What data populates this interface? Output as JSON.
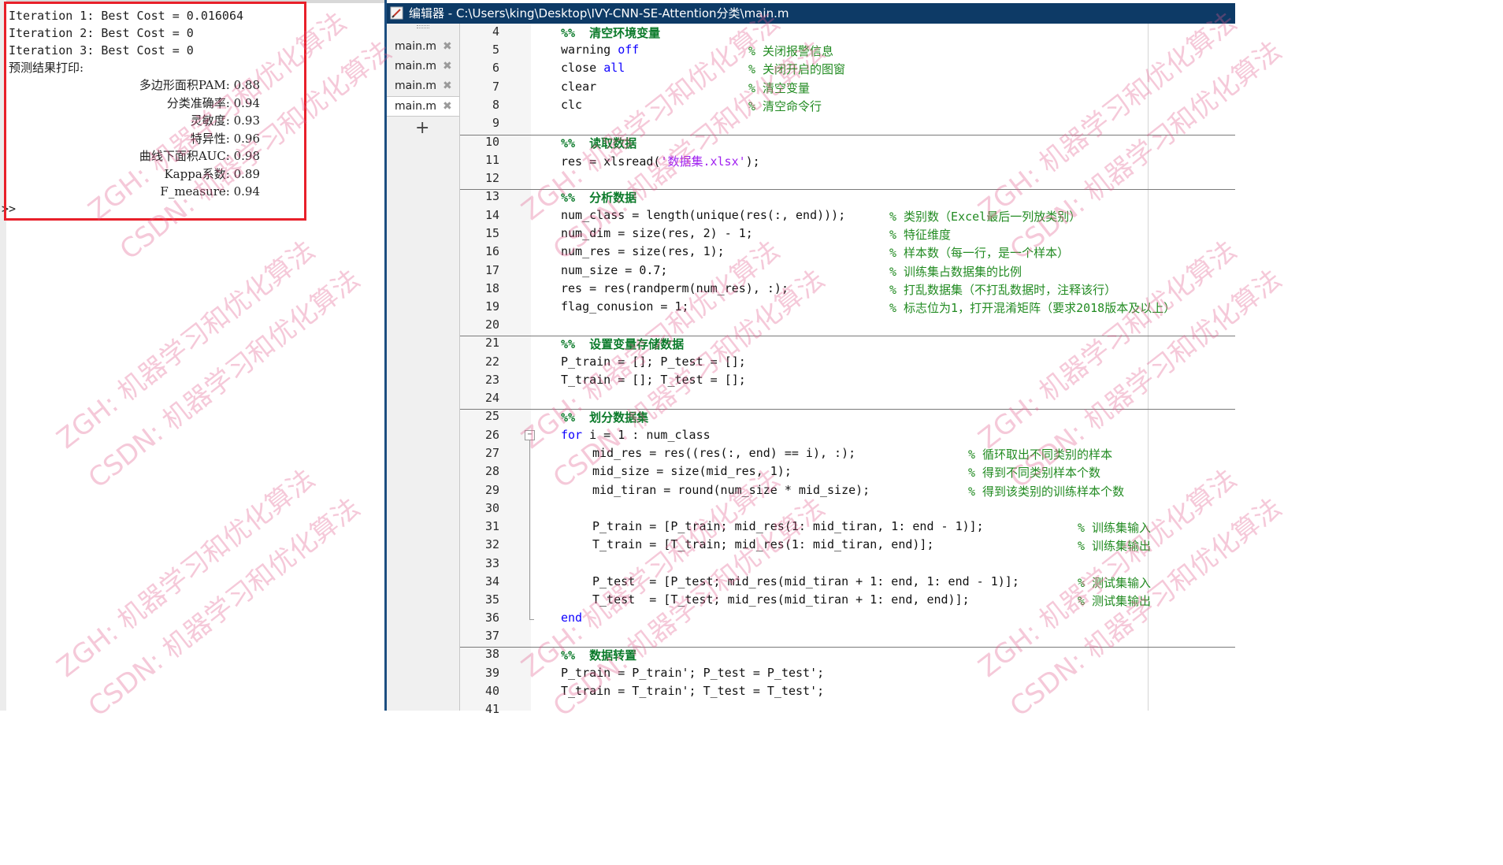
{
  "command_window": {
    "iterations": [
      "Iteration 1: Best Cost = 0.016064",
      "Iteration 2: Best Cost = 0",
      "Iteration 3: Best Cost = 0"
    ],
    "print_header": "预测结果打印:",
    "metrics": [
      "多边形面积PAM: 0.88",
      "分类准确率: 0.94",
      "灵敏度: 0.93",
      "特异性: 0.96",
      "曲线下面积AUC: 0.98",
      "Kappa系数: 0.89",
      "F_measure: 0.94"
    ],
    "prompt": ">>"
  },
  "editor": {
    "title": "编辑器 - C:\\Users\\king\\Desktop\\IVY-CNN-SE-Attention分类\\main.m",
    "tabs": [
      {
        "label": "main.m",
        "active": false
      },
      {
        "label": "main.m",
        "active": false
      },
      {
        "label": "main.m",
        "active": false
      },
      {
        "label": "main.m",
        "active": true
      }
    ],
    "close_glyph": "✖",
    "add_tab_glyph": "+",
    "fold_glyph": "−",
    "line_numbers": [
      "4",
      "5",
      "6",
      "7",
      "8",
      "9",
      "10",
      "11",
      "12",
      "13",
      "14",
      "15",
      "16",
      "17",
      "18",
      "19",
      "20",
      "21",
      "22",
      "23",
      "24",
      "25",
      "26",
      "27",
      "28",
      "29",
      "30",
      "31",
      "32",
      "33",
      "34",
      "35",
      "36",
      "37",
      "38",
      "39",
      "40",
      "41"
    ],
    "code": {
      "l4_marker": "%%",
      "l4_title": "清空环境变量",
      "l5_a": "warning ",
      "l5_kw": "off",
      "l6_a": "close ",
      "l6_kw": "all",
      "l7": "clear",
      "l8": "clc",
      "l10_marker": "%%",
      "l10_title": "读取数据",
      "l11_a": "res = xlsread(",
      "l11_str": "'数据集.xlsx'",
      "l11_b": ");",
      "l13_marker": "%%",
      "l13_title": "分析数据",
      "l14": "num_class = length(unique(res(:, end)));",
      "l15": "num_dim = size(res, 2) - 1;",
      "l16": "num_res = size(res, 1);",
      "l17": "num_size = 0.7;",
      "l18": "res = res(randperm(num_res), :);",
      "l19": "flag_conusion = 1;",
      "l21_marker": "%%",
      "l21_title": "设置变量存储数据",
      "l22": "P_train = []; P_test = [];",
      "l23": "T_train = []; T_test = [];",
      "l25_marker": "%%",
      "l25_title": "划分数据集",
      "l26_kw": "for",
      "l26_a": " i = 1 : num_class",
      "l27": "mid_res = res((res(:, end) == i), :);",
      "l28": "mid_size = size(mid_res, 1);",
      "l29": "mid_tiran = round(num_size * mid_size);",
      "l31": "P_train = [P_train; mid_res(1: mid_tiran, 1: end - 1)];",
      "l32": "T_train = [T_train; mid_res(1: mid_tiran, end)];",
      "l34": "P_test  = [P_test; mid_res(mid_tiran + 1: end, 1: end - 1)];",
      "l35": "T_test  = [T_test; mid_res(mid_tiran + 1: end, end)];",
      "l36_kw": "end",
      "l38_marker": "%%",
      "l38_title": "数据转置",
      "l39": "P_train = P_train'; P_test = P_test';",
      "l40": "T_train = T_train'; T_test = T_test';"
    },
    "comments": {
      "c5": "% 关闭报警信息",
      "c6": "% 关闭开启的图窗",
      "c7": "% 清空变量",
      "c8": "% 清空命令行",
      "c14": "% 类别数（Excel最后一列放类别）",
      "c15": "% 特征维度",
      "c16": "% 样本数（每一行，是一个样本）",
      "c17": "% 训练集占数据集的比例",
      "c18": "% 打乱数据集（不打乱数据时，注释该行）",
      "c19": "% 标志位为1，打开混淆矩阵（要求2018版本及以上）",
      "c27": "% 循环取出不同类别的样本",
      "c28": "% 得到不同类别样本个数",
      "c29": "% 得到该类别的训练样本个数",
      "c31": "% 训练集输入",
      "c32": "% 训练集输出",
      "c34": "% 测试集输入",
      "c35": "% 测试集输出"
    }
  },
  "watermarks": {
    "zgh": "ZGH: 机器学习和优化算法",
    "csdn": "CSDN: 机器学习和优化算法"
  },
  "colors": {
    "highlight_box": "#e8202a",
    "titlebar": "#0d3a66",
    "keyword": "#0e00ff",
    "string": "#a020f0",
    "comment": "#228b22"
  }
}
